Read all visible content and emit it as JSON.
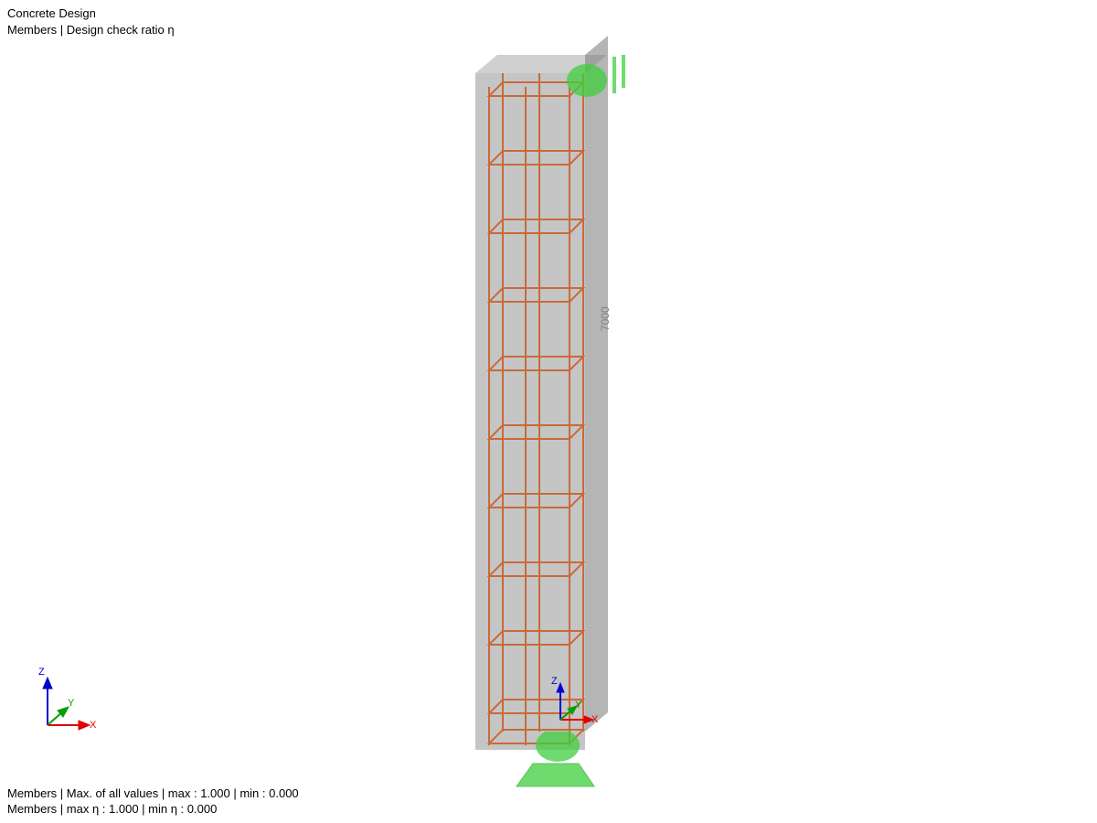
{
  "header": {
    "line1": "Concrete Design",
    "line2": "Members | Design check ratio η"
  },
  "footer": {
    "line1": "Members | Max. of all values | max  : 1.000 | min  : 0.000",
    "line2": "Members | max η : 1.000 | min η : 0.000"
  },
  "model": {
    "dimension_label": "7000"
  },
  "axes": {
    "x": "X",
    "y": "Y",
    "z": "Z"
  }
}
